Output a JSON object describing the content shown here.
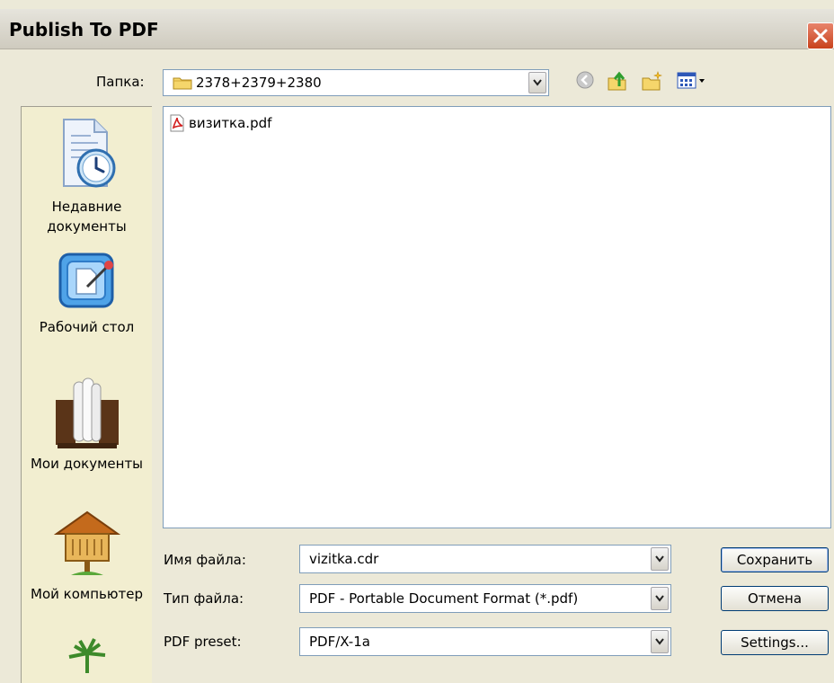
{
  "title": "Publish To PDF",
  "folder": {
    "label": "Папка:",
    "value": "2378+2379+2380"
  },
  "places": [
    {
      "label_1": "Недавние",
      "label_2": "документы",
      "icon": "recent-documents-icon"
    },
    {
      "label_1": "Рабочий стол",
      "label_2": "",
      "icon": "desktop-icon"
    },
    {
      "label_1": "Мои документы",
      "label_2": "",
      "icon": "my-documents-icon"
    },
    {
      "label_1": "Мой компьютер",
      "label_2": "",
      "icon": "my-computer-icon"
    }
  ],
  "files": [
    {
      "name": "визитка.pdf",
      "icon": "pdf-file-icon"
    }
  ],
  "filename": {
    "label": "Имя файла:",
    "value": "vizitka.cdr"
  },
  "filetype": {
    "label": "Тип файла:",
    "value": "PDF - Portable Document Format (*.pdf)"
  },
  "preset": {
    "label": "PDF preset:",
    "value": "PDF/X-1a"
  },
  "buttons": {
    "save": "Сохранить",
    "cancel": "Отмена",
    "settings": "Settings..."
  },
  "colors": {
    "title_bar": "#d8d5cb",
    "close_button": "#d9541e",
    "dialog_bg": "#ece9d8",
    "places_bg": "#f2eed0",
    "field_border": "#7f9db9"
  }
}
